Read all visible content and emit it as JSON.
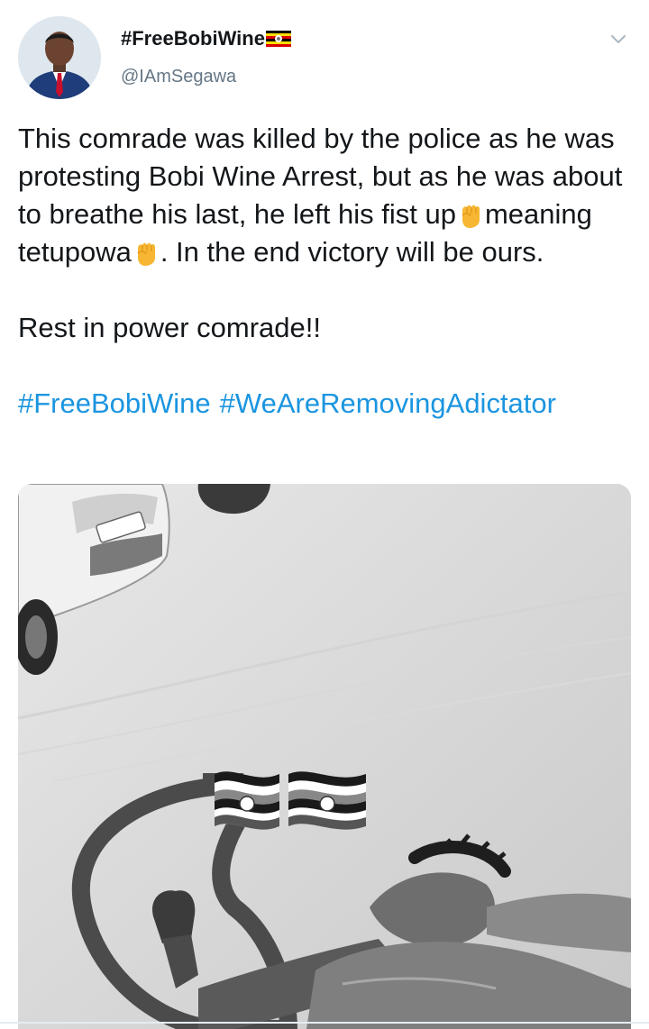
{
  "user": {
    "display_name": "#FreeBobiWine",
    "flag_emoji": "uganda-flag",
    "handle": "@IAmSegawa"
  },
  "tweet": {
    "line1": "This comrade was killed by the police as he was protesting Bobi Wine Arrest, but as he was about to breathe his last, he left his fist up",
    "line1b": "meaning tetupowa",
    "line1c": ". In the end victory will be ours.",
    "line2": "Rest in power comrade!!",
    "hashtags": [
      "#FreeBobiWine",
      "#WeAreRemovingAdictator"
    ]
  },
  "icons": {
    "menu": "chevron-down-icon",
    "fist": "raised-fist-emoji"
  },
  "colors": {
    "text": "#14171a",
    "secondary": "#657786",
    "link": "#1b95e0",
    "fist": "#f7b733"
  }
}
